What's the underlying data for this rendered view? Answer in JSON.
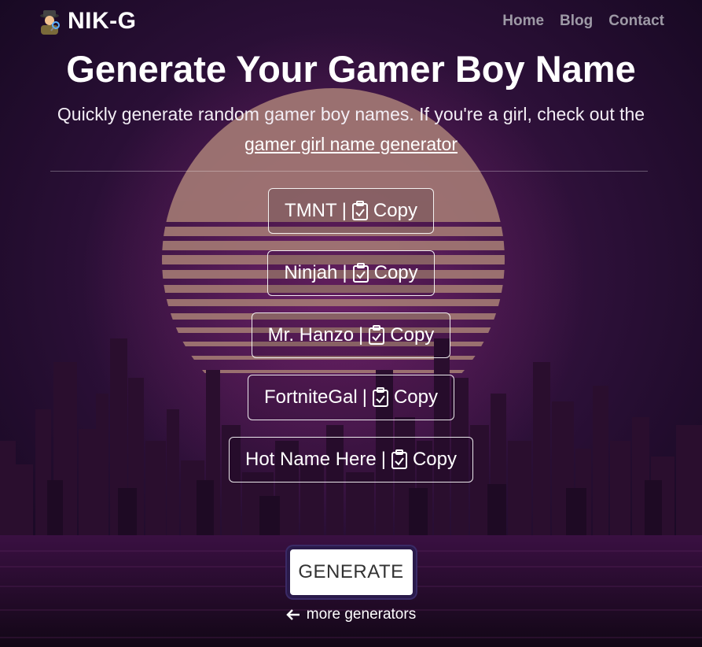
{
  "nav": {
    "brand": "NIK-G",
    "links": [
      "Home",
      "Blog",
      "Contact"
    ]
  },
  "hero": {
    "title": "Generate Your Gamer Boy Name",
    "subtitle_prefix": "Quickly generate random gamer boy names. If you're a girl, check out the ",
    "subtitle_link": "gamer girl name generator"
  },
  "names": [
    {
      "name": "TMNT",
      "separator": "|",
      "copy": "Copy"
    },
    {
      "name": "Ninjah",
      "separator": "|",
      "copy": "Copy"
    },
    {
      "name": "Mr. Hanzo",
      "separator": "|",
      "copy": "Copy"
    },
    {
      "name": "FortniteGal",
      "separator": "|",
      "copy": "Copy"
    },
    {
      "name": "Hot Name Here",
      "separator": "|",
      "copy": "Copy"
    }
  ],
  "actions": {
    "generate": "GENERATE",
    "more": "more generators"
  },
  "colors": {
    "background": "#1c0a26",
    "sun": "#b88a74",
    "nav_link": "#9e9aa6"
  },
  "icons": {
    "brand": "detective-icon",
    "copy": "clipboard-check-icon",
    "more": "arrow-left-icon"
  }
}
